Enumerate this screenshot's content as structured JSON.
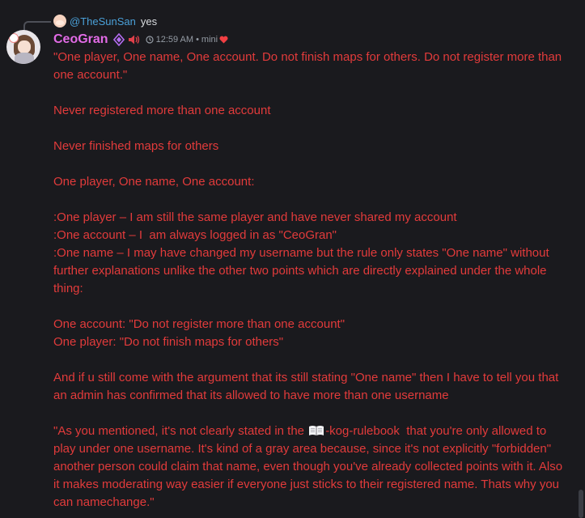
{
  "reply": {
    "avatar_icon": "user-avatar-icon",
    "username": "@TheSunSan",
    "text": "yes"
  },
  "message": {
    "username": "CeoGran",
    "username_color": "#e26be6",
    "role_icon": "purple-gem-role-icon",
    "speaker_icon": "speaker-muted-icon",
    "time": "12:59 AM",
    "separator": "•",
    "tag": "mini",
    "tag_icon": "red-heart-icon",
    "text_color": "#e23b3b",
    "lines": [
      "\"One player, One name, One account. Do not finish maps for others. Do not register more than one account.\"",
      "",
      "Never registered more than one account",
      "",
      "Never finished maps for others",
      "",
      "One player, One name, One account:",
      "",
      ":One player – I am still the same player and have never shared my account",
      ":One account – I  am always logged in as \"CeoGran\"",
      ":One name – I may have changed my username but the rule only states \"One name\" without further explanations unlike the other two points which are directly explained under the whole thing:",
      "",
      "One account: \"Do not register more than one account\"",
      "One player: \"Do not finish maps for others\"",
      "",
      "And if u still come with the argument that its still stating \"One name\" then I have to tell you that an admin has confirmed that its allowed to have more than one username",
      ""
    ],
    "quote_before_channel": "\"As you mentioned, it's not clearly stated in the ",
    "channel_name": "-kog-rulebook",
    "quote_after_channel": "  that you're only allowed to play under one username. It's kind of a gray area because, since it's not explicitly \"forbidden\" another person could claim that name, even though you've already collected points with it. Also it makes moderating way easier if everyone just sticks to their registered name. Thats why you can namechange.\""
  }
}
